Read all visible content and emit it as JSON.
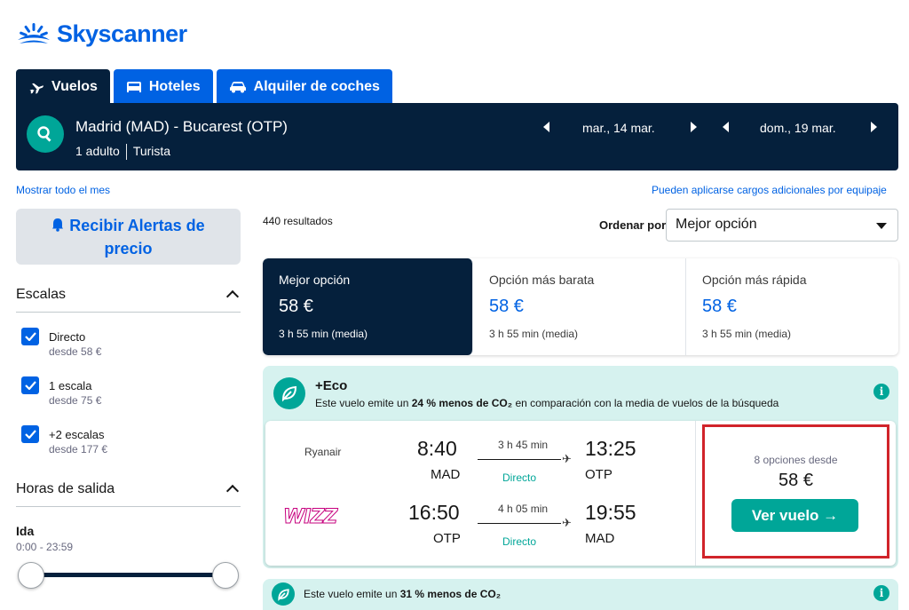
{
  "brand": {
    "name": "Skyscanner",
    "color": "#0062e3",
    "logo_icon": "sunrise-icon"
  },
  "tabs": [
    {
      "label": "Vuelos",
      "icon": "plane-icon",
      "active": true
    },
    {
      "label": "Hoteles",
      "icon": "bed-icon",
      "active": false
    },
    {
      "label": "Alquiler de coches",
      "icon": "car-icon",
      "active": false
    }
  ],
  "search": {
    "route": "Madrid (MAD) - Bucarest (OTP)",
    "passengers": "1 adulto",
    "cabin": "Turista",
    "depart_date": "mar., 14 mar.",
    "return_date": "dom., 19 mar."
  },
  "links": {
    "show_month": "Mostrar todo el mes",
    "baggage_fees": "Pueden aplicarse cargos adicionales por equipaje"
  },
  "sidebar": {
    "price_alert": "Recibir Alertas de precio",
    "stops_title": "Escalas",
    "stops": [
      {
        "label": "Directo",
        "sub": "desde 58 €",
        "checked": true
      },
      {
        "label": "1 escala",
        "sub": "desde 75 €",
        "checked": true
      },
      {
        "label": "+2 escalas",
        "sub": "desde 177 €",
        "checked": true
      }
    ],
    "departure_title": "Horas de salida",
    "outbound_label": "Ida",
    "outbound_range": "0:00 - 23:59"
  },
  "results": {
    "count": "440 resultados",
    "sort_label": "Ordenar por",
    "sort_value": "Mejor opción"
  },
  "sort_tabs": [
    {
      "title": "Mejor opción",
      "price": "58 €",
      "sub": "3 h 55 min (media)",
      "active": true
    },
    {
      "title": "Opción más barata",
      "price": "58 €",
      "sub": "3 h 55 min (media)",
      "active": false
    },
    {
      "title": "Opción más rápida",
      "price": "58 €",
      "sub": "3 h 55 min (media)",
      "active": false
    }
  ],
  "card1": {
    "eco_title": "+Eco",
    "eco_pre": "Este vuelo emite un ",
    "eco_bold": "24 % menos de CO₂",
    "eco_post": " en comparación con la media de vuelos de la búsqueda",
    "outbound": {
      "airline": "Ryanair",
      "dep_time": "8:40",
      "dep_code": "MAD",
      "duration": "3 h 45 min",
      "stops": "Directo",
      "arr_time": "13:25",
      "arr_code": "OTP"
    },
    "inbound": {
      "airline": "WIZZ",
      "dep_time": "16:50",
      "dep_code": "OTP",
      "duration": "4 h 05 min",
      "stops": "Directo",
      "arr_time": "19:55",
      "arr_code": "MAD"
    },
    "options_text": "8 opciones desde",
    "price": "58 €",
    "cta": "Ver vuelo →"
  },
  "card2": {
    "eco_pre": "Este vuelo emite un ",
    "eco_bold": "31 % menos de CO₂"
  }
}
